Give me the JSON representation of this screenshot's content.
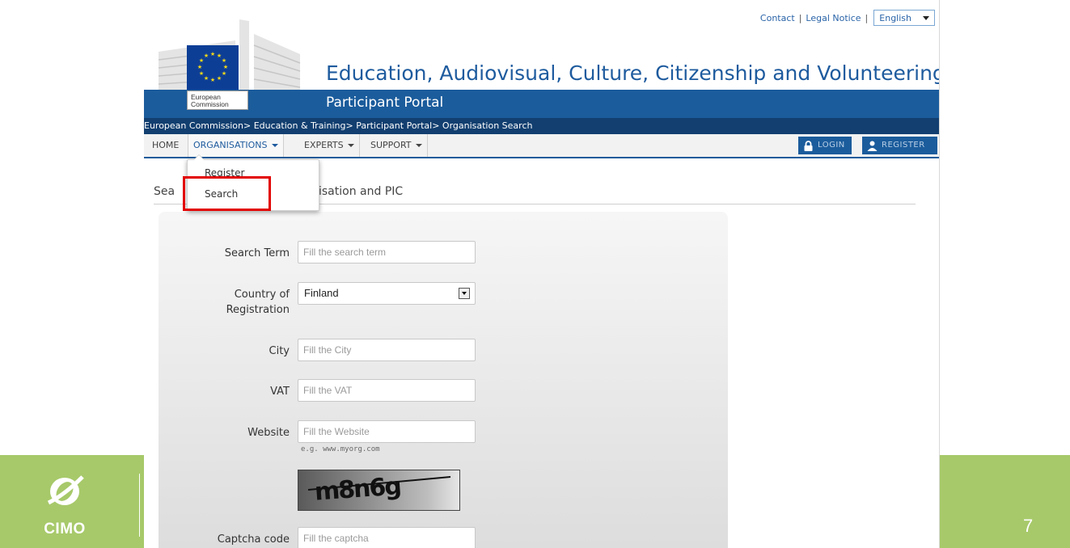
{
  "top_links": {
    "contact": "Contact",
    "legal_notice": "Legal Notice",
    "separator": "|",
    "language": "English"
  },
  "header": {
    "ec_label_line1": "European",
    "ec_label_line2": "Commission",
    "title": "Education, Audiovisual, Culture, Citizenship and Volunteering",
    "portal": "Participant Portal"
  },
  "breadcrumb": {
    "items": [
      "European Commission",
      "Education & Training",
      "Participant Portal",
      "Organisation Search"
    ],
    "separator": "> "
  },
  "nav": {
    "home": "HOME",
    "organisations": "ORGANISATIONS",
    "experts": "EXPERTS",
    "support": "SUPPORT",
    "login": "LOGIN",
    "register": "REGISTER"
  },
  "dropdown": {
    "register": "Register",
    "search": "Search"
  },
  "section": {
    "title_left": "Sea",
    "title_right": "isation and PIC"
  },
  "form": {
    "search_term_label": "Search Term",
    "search_term_placeholder": "Fill the search term",
    "country_label_line1": "Country of",
    "country_label_line2": "Registration",
    "country_value": "Finland",
    "city_label": "City",
    "city_placeholder": "Fill the City",
    "vat_label": "VAT",
    "vat_placeholder": "Fill the VAT",
    "website_label": "Website",
    "website_placeholder": "Fill the Website",
    "website_hint": "e.g. www.myorg.com",
    "captcha_image_text": "m8n6g",
    "captcha_label": "Captcha code",
    "captcha_placeholder": "Fill the captcha"
  },
  "slide": {
    "logo_text": "CIMO",
    "page_number": "7"
  },
  "colors": {
    "ec_blue": "#1b5c9c",
    "breadcrumb_navy": "#123f70",
    "slide_green": "#a7c96a",
    "highlight_red": "#e20000"
  }
}
